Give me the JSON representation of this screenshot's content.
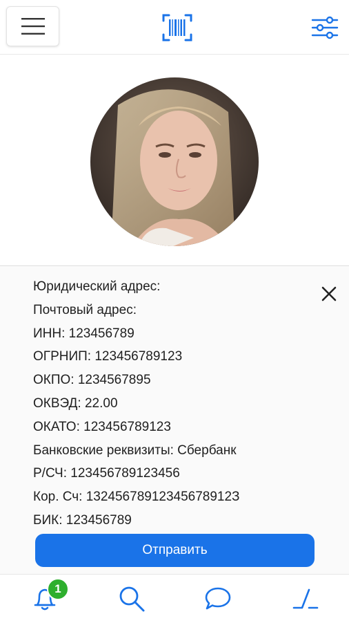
{
  "profile": {
    "fields": [
      "Юридический адрес:",
      "Почтовый адрес:",
      "ИНН: 123456789",
      "ОГРНИП: 123456789123",
      "ОКПО: 1234567895",
      "ОКВЭД: 22.00",
      "ОКАТО: 123456789123",
      "Банковские реквизиты: Сбербанк",
      "Р/СЧ: 123456789123456",
      "Кор. Сч: 13245678912345678912З",
      "БИК: 123456789"
    ]
  },
  "actions": {
    "submit_label": "Отправить"
  },
  "bottom_nav": {
    "notifications_badge": "1"
  },
  "icons": {
    "menu": "hamburger-icon",
    "barcode": "barcode-scan-icon",
    "filter": "filter-sliders-icon",
    "close": "close-icon",
    "bell": "bell-icon",
    "search": "search-icon",
    "chat": "chat-icon",
    "signal": "signal-step-icon"
  },
  "colors": {
    "accent": "#1a73e8",
    "badge": "#2eaf2e"
  }
}
